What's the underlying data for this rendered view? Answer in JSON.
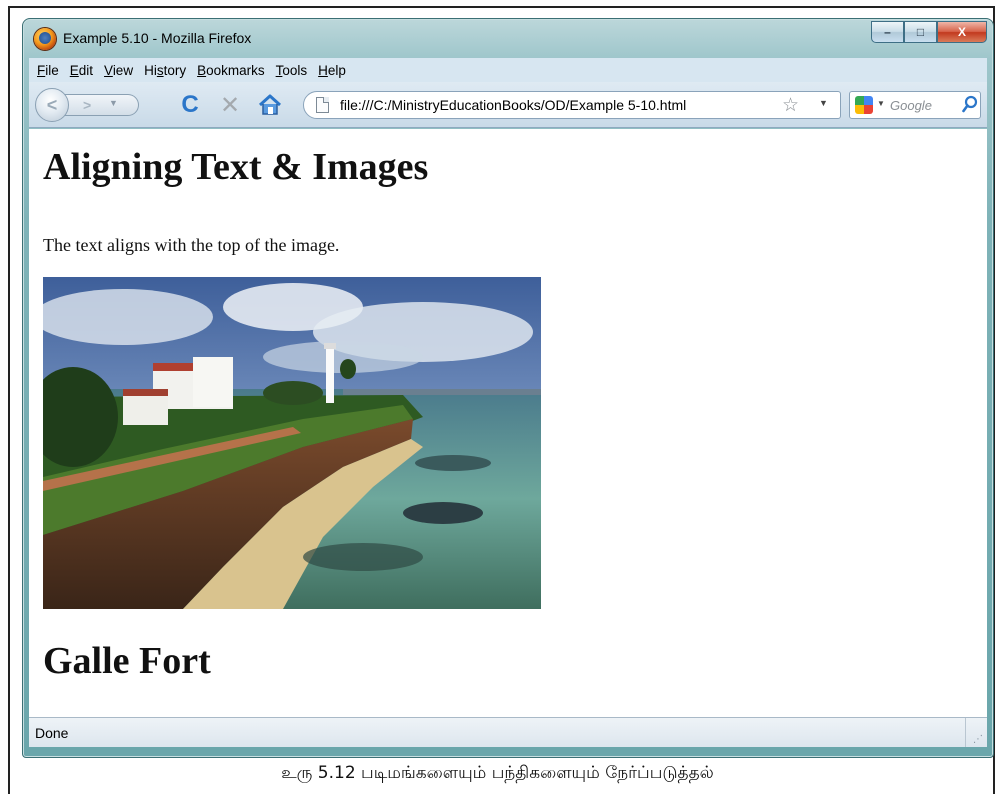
{
  "window": {
    "title": "Example 5.10 - Mozilla Firefox",
    "controls": {
      "minimize": "–",
      "maximize": "□",
      "close": "X"
    }
  },
  "menu": {
    "items": [
      {
        "key": "F",
        "rest": "ile"
      },
      {
        "key": "E",
        "rest": "dit"
      },
      {
        "key": "V",
        "rest": "iew"
      },
      {
        "pre": "Hi",
        "key": "s",
        "rest": "tory"
      },
      {
        "key": "B",
        "rest": "ookmarks"
      },
      {
        "key": "T",
        "rest": "ools"
      },
      {
        "key": "H",
        "rest": "elp"
      }
    ]
  },
  "navigation": {
    "back_icon": "back-arrow-icon",
    "forward_icon": "forward-arrow-icon",
    "reload_icon": "reload-icon",
    "stop_icon": "stop-icon",
    "home_icon": "home-icon",
    "url": "file:///C:/MinistryEducationBooks/OD/Example 5-10.html",
    "search_placeholder": "Google"
  },
  "page": {
    "heading": "Aligning Text & Images",
    "paragraph": "The text aligns with the top of the image.",
    "subheading": "Galle Fort"
  },
  "status": {
    "text": "Done"
  },
  "figure_caption": "உரு 5.12 படிமங்களையும் பந்திகளையும் நேர்ப்படுத்தல்",
  "colors": {
    "window_frame": "#7fb3b8",
    "menubar_bg": "#d7e6f1",
    "reload_blue": "#2b76c9",
    "close_red": "#c2391e"
  }
}
